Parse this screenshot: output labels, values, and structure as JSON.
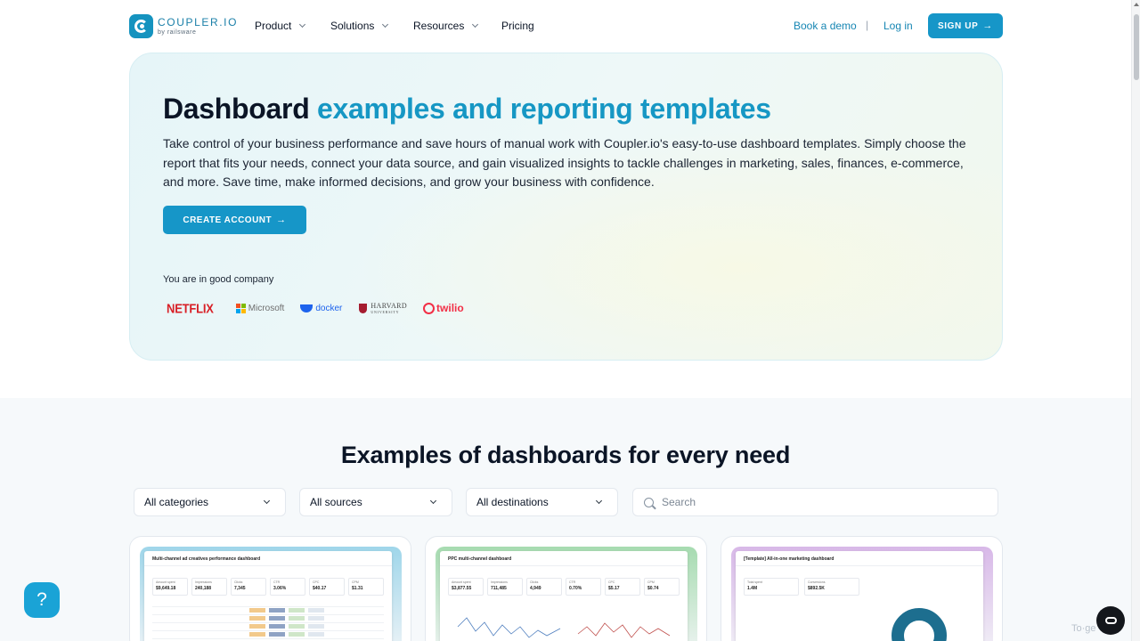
{
  "brand": {
    "name": "COUPLER.IO",
    "sub": "by railsware"
  },
  "nav": {
    "product": "Product",
    "solutions": "Solutions",
    "resources": "Resources",
    "pricing": "Pricing",
    "book_demo": "Book a demo",
    "separator": "|",
    "login": "Log in",
    "signup": "SIGN UP"
  },
  "hero": {
    "title_plain": "Dashboard",
    "title_accent": "examples and reporting templates",
    "description": "Take control of your business performance and save hours of manual work with Coupler.io's easy-to-use dashboard templates. Simply choose the report that fits your needs, connect your data source, and gain visualized insights to tackle challenges in marketing, sales, finances, e-commerce, and more. Save time, make informed decisions, and grow your business with confidence.",
    "cta": "CREATE ACCOUNT",
    "company_label": "You are in good company",
    "logos": {
      "netflix": "NETFLIX",
      "microsoft": "Microsoft",
      "docker": "docker",
      "harvard": "HARVARD",
      "harvard_sub": "UNIVERSITY",
      "twilio": "twilio"
    }
  },
  "examples": {
    "title": "Examples of dashboards for every need",
    "filters": {
      "categories": "All categories",
      "sources": "All sources",
      "destinations": "All destinations"
    },
    "search_placeholder": "Search",
    "cards": [
      {
        "title": "Multi-channel ad creatives performance dashboard",
        "gradient": "#9fd6ea",
        "kpis": [
          [
            "Amount spent",
            "$9,649.18"
          ],
          [
            "Impressions",
            "240,188"
          ],
          [
            "Clicks",
            "7,345"
          ],
          [
            "CTR",
            "3.06%"
          ],
          [
            "CPC",
            "$40.17"
          ],
          [
            "CPM",
            "$1.31"
          ]
        ]
      },
      {
        "title": "PPC multi-channel dashboard",
        "gradient": "#a6dbb0",
        "kpis": [
          [
            "Amount spent",
            "$3,877.55"
          ],
          [
            "Impressions",
            "711,485"
          ],
          [
            "Clicks",
            "4,949"
          ],
          [
            "CTR",
            "0.70%"
          ],
          [
            "CPC",
            "$5.17"
          ],
          [
            "CPM",
            "$0.74"
          ]
        ]
      },
      {
        "title": "[Template] All-in-one marketing dashboard",
        "gradient": "#d8b8e8",
        "kpis": [
          [
            "Total spent",
            "1.4M"
          ],
          [
            "Conversions",
            "$892.5K"
          ]
        ]
      }
    ]
  },
  "help_icon": "?",
  "translate_text": "To",
  "translate_suffix": "ge"
}
